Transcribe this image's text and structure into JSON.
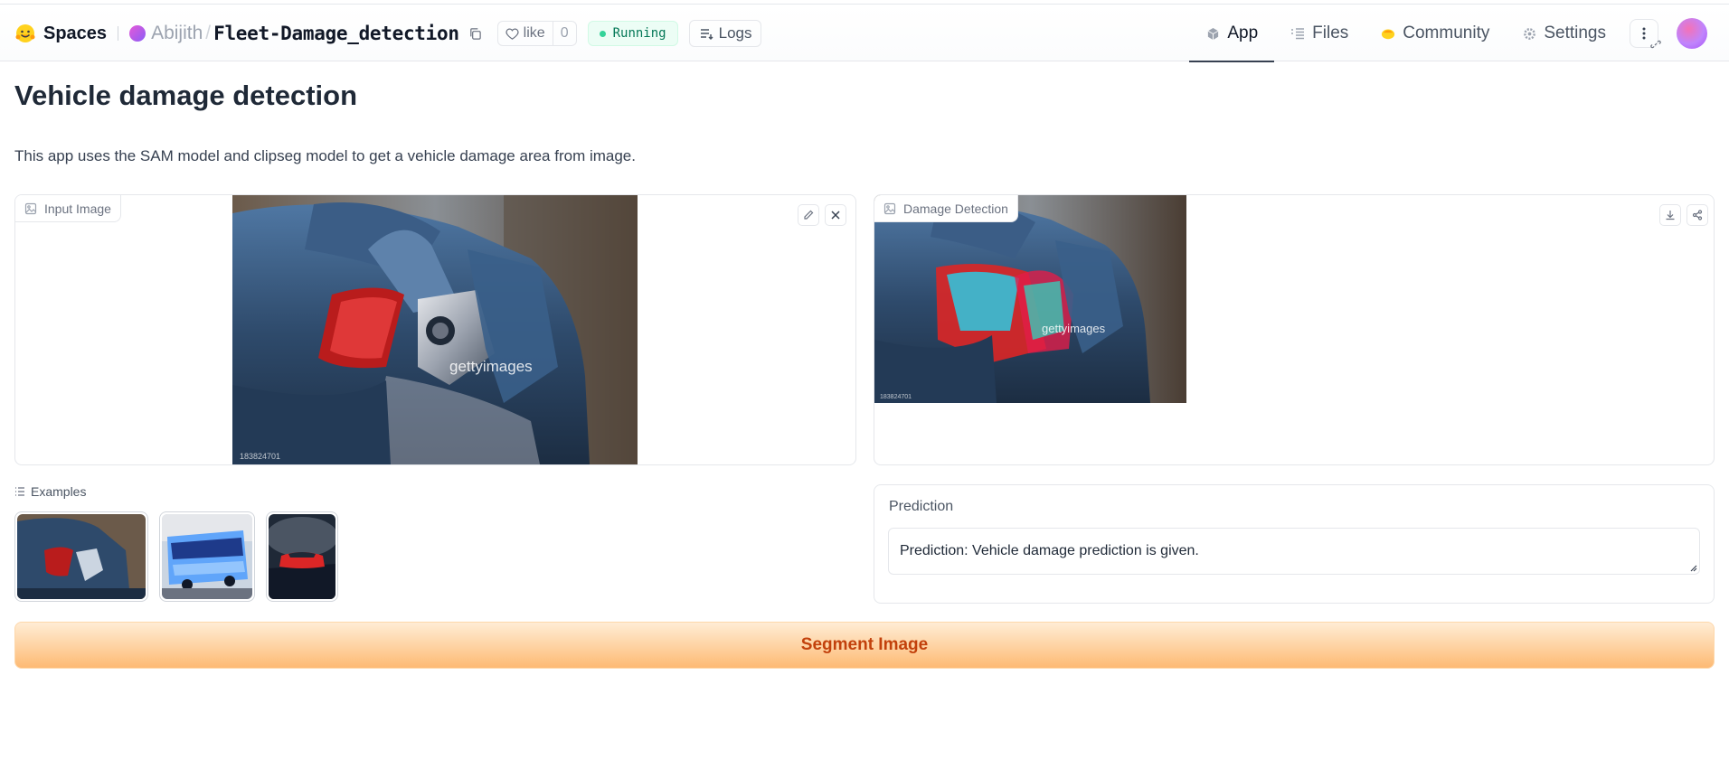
{
  "nav": {
    "brand": "Spaces",
    "owner": "Abijith",
    "separator": "/",
    "repo": "Fleet-Damage_detection",
    "like_label": "like",
    "like_count": "0",
    "status": "Running",
    "logs_label": "Logs",
    "tabs": [
      {
        "label": "App",
        "icon": "app-cube-icon",
        "active": true
      },
      {
        "label": "Files",
        "icon": "files-icon",
        "active": false
      },
      {
        "label": "Community",
        "icon": "community-icon",
        "active": false
      },
      {
        "label": "Settings",
        "icon": "gear-icon",
        "active": false
      }
    ]
  },
  "main": {
    "title": "Vehicle damage detection",
    "description": "This app uses the SAM model and clipseg model to get a vehicle damage area from image.",
    "input_panel": {
      "label": "Input Image",
      "watermark": "gettyimages",
      "image_id": "183824701"
    },
    "output_panel": {
      "label": "Damage Detection",
      "watermark": "gettyimages",
      "image_id": "183824701"
    },
    "examples_label": "Examples",
    "prediction": {
      "label": "Prediction",
      "value": "Prediction: Vehicle damage prediction is given."
    },
    "segment_button": "Segment Image"
  },
  "colors": {
    "accent_orange": "#c2410c",
    "running_green": "#047857",
    "car_blue": "#2e4a6b"
  }
}
